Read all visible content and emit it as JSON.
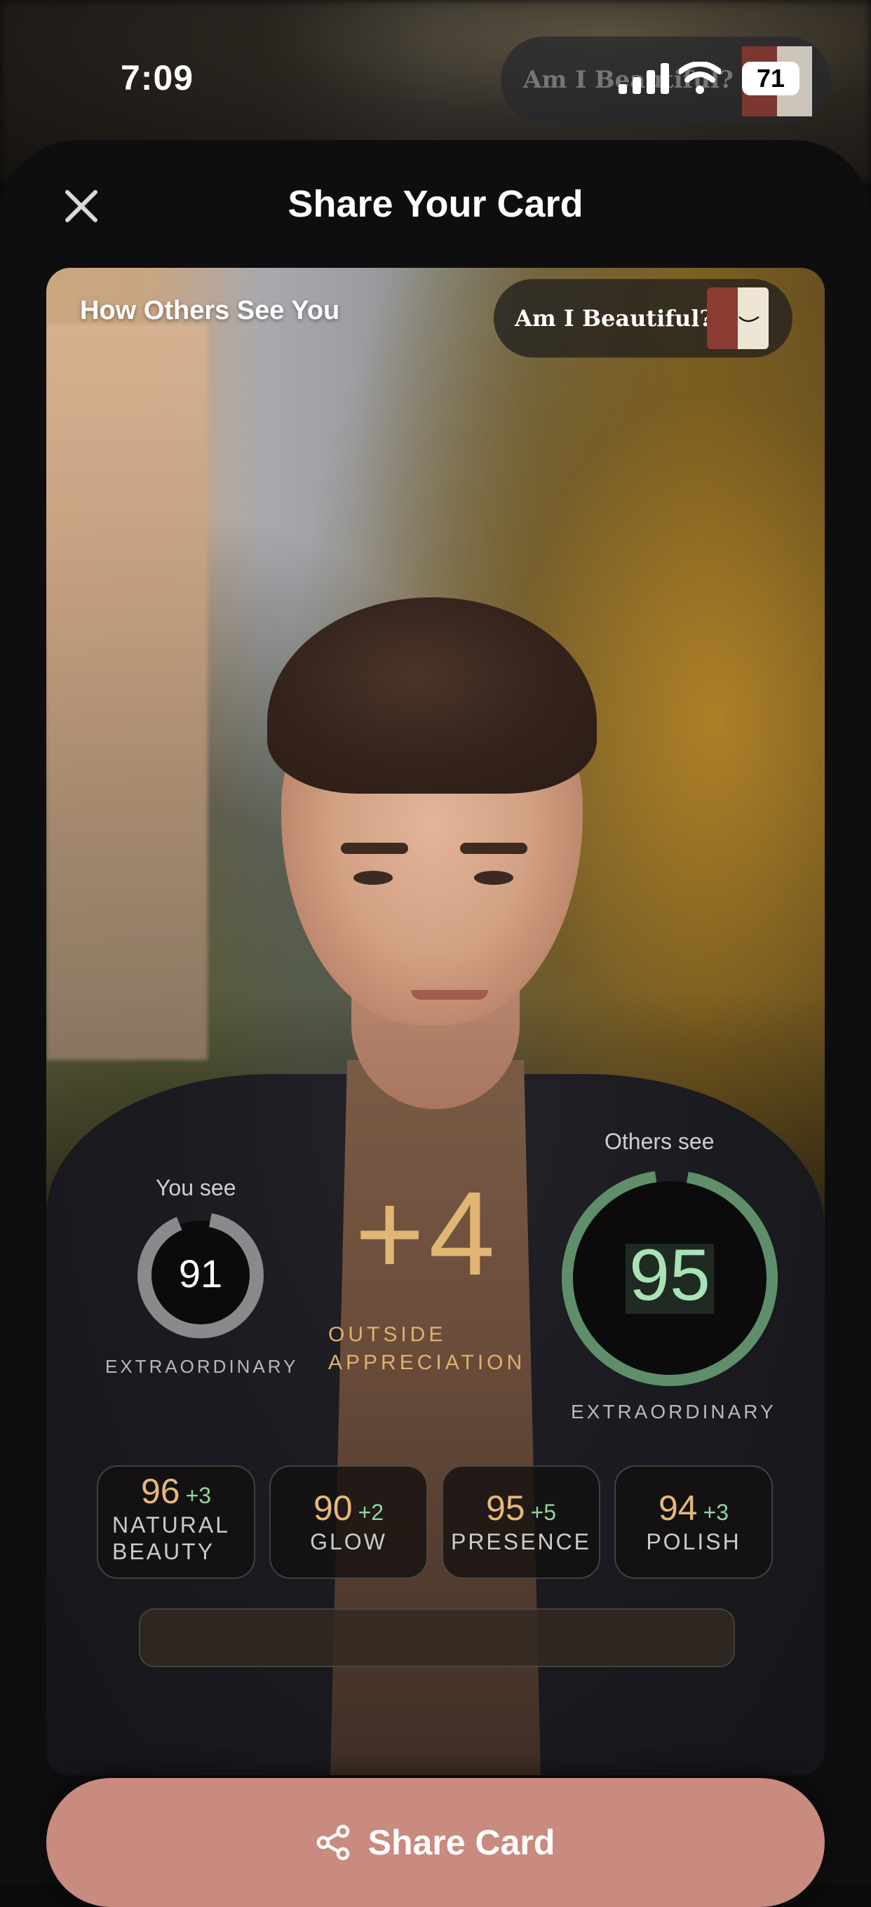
{
  "status_bar": {
    "time": "7:09",
    "battery": "71",
    "ghost_brand": "Am I Beautiful?"
  },
  "sheet": {
    "title": "Share Your Card"
  },
  "card": {
    "label": "How Others See You",
    "brand": "Am I Beautiful?",
    "you_see_label": "You see",
    "you_score": "91",
    "you_tier": "EXTRAORDINARY",
    "you_progress": 0.91,
    "delta": "+4",
    "delta_caption_1": "OUTSIDE",
    "delta_caption_2": "APPRECIATION",
    "others_label": "Others see",
    "others_score": "95",
    "others_tier": "EXTRAORDINARY",
    "others_progress": 0.95,
    "metrics": [
      {
        "score": "96",
        "delta": "+3",
        "name_1": "NATURAL",
        "name_2": "BEAUTY"
      },
      {
        "score": "90",
        "delta": "+2",
        "name_1": "GLOW",
        "name_2": ""
      },
      {
        "score": "95",
        "delta": "+5",
        "name_1": "PRESENCE",
        "name_2": ""
      },
      {
        "score": "94",
        "delta": "+3",
        "name_1": "POLISH",
        "name_2": ""
      }
    ]
  },
  "share_button": {
    "label": "Share Card",
    "icon": "share-icon"
  },
  "colors": {
    "accent": "#c98a7f",
    "gold": "#e1b574",
    "green": "#5f8f6a",
    "delta_green": "#8fd6a3"
  }
}
